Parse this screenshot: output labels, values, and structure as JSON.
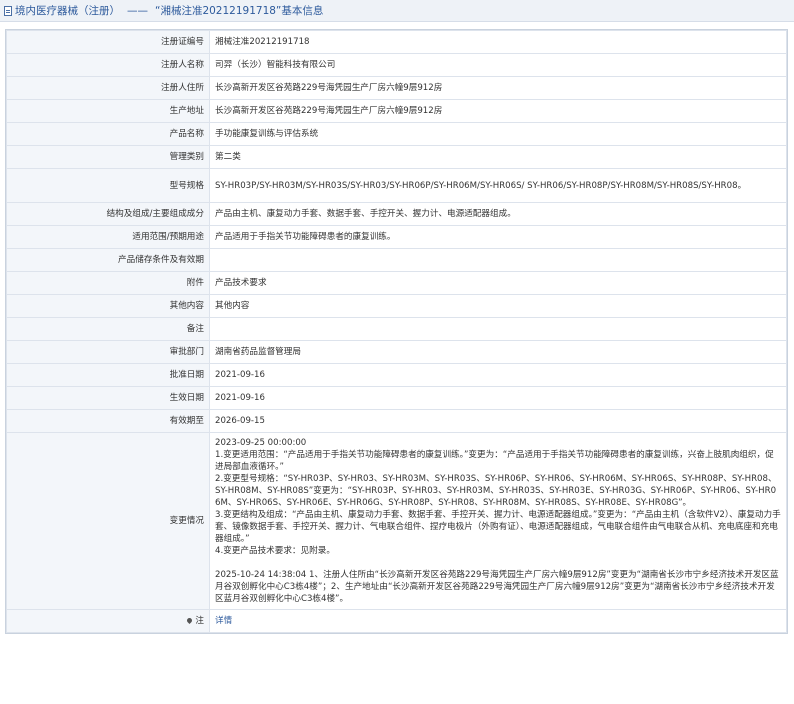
{
  "header": {
    "category": "境内医疗器械（注册）",
    "separator": "——",
    "subject": "“湘械注准20212191718”基本信息"
  },
  "rows": [
    {
      "label": "注册证编号",
      "value": "湘械注准20212191718"
    },
    {
      "label": "注册人名称",
      "value": "司羿（长沙）智能科技有限公司"
    },
    {
      "label": "注册人住所",
      "value": "长沙高新开发区谷苑路229号海凭园生产厂房六幢9层912房"
    },
    {
      "label": "生产地址",
      "value": "长沙高新开发区谷苑路229号海凭园生产厂房六幢9层912房"
    },
    {
      "label": "产品名称",
      "value": "手功能康复训练与评估系统"
    },
    {
      "label": "管理类别",
      "value": "第二类"
    },
    {
      "label": "型号规格",
      "value": "SY-HR03P/SY-HR03M/SY-HR03S/SY-HR03/SY-HR06P/SY-HR06M/SY-HR06S/ SY-HR06/SY-HR08P/SY-HR08M/SY-HR08S/SY-HR08。"
    },
    {
      "label": "结构及组成/主要组成成分",
      "value": "产品由主机、康复动力手套、数据手套、手控开关、握力计、电源适配器组成。"
    },
    {
      "label": "适用范围/预期用途",
      "value": "产品适用于手指关节功能障碍患者的康复训练。"
    },
    {
      "label": "产品储存条件及有效期",
      "value": ""
    },
    {
      "label": "附件",
      "value": "产品技术要求"
    },
    {
      "label": "其他内容",
      "value": "其他内容"
    },
    {
      "label": "备注",
      "value": ""
    },
    {
      "label": "审批部门",
      "value": "湖南省药品监督管理局"
    },
    {
      "label": "批准日期",
      "value": "2021-09-16"
    },
    {
      "label": "生效日期",
      "value": "2021-09-16"
    },
    {
      "label": "有效期至",
      "value": "2026-09-15"
    }
  ],
  "change": {
    "label": "变更情况",
    "lines1": [
      "2023-09-25 00:00:00",
      "1.变更适用范围：“产品适用于手指关节功能障碍患者的康复训练。”变更为：“产品适用于手指关节功能障碍患者的康复训练，兴奋上肢肌肉组织，促进局部血液循环。”",
      "2.变更型号规格：“SY-HR03P、SY-HR03、SY-HR03M、SY-HR03S、SY-HR06P、SY-HR06、SY-HR06M、SY-HR06S、SY-HR08P、SY-HR08、SY-HR08M、SY-HR08S”变更为：“SY-HR03P、SY-HR03、SY-HR03M、SY-HR03S、SY-HR03E、SY-HR03G、SY-HR06P、SY-HR06、SY-HR06M、SY-HR06S、SY-HR06E、SY-HR06G、SY-HR08P、SY-HR08、SY-HR08M、SY-HR08S、SY-HR08E、SY-HR08G”。",
      "3.变更结构及组成：“产品由主机、康复动力手套、数据手套、手控开关、握力计、电源适配器组成。”变更为：“产品由主机（含软件V2）、康复动力手套、镜像数据手套、手控开关、握力计、气电联合组件、捏疗电极片（外购有证）、电源适配器组成，气电联合组件由气电联合从机、充电底座和充电器组成。”",
      "4.变更产品技术要求：见附录。"
    ],
    "lines2": [
      "2025-10-24 14:38:04 1、注册人住所由“长沙高新开发区谷苑路229号海凭园生产厂房六幢9层912房”变更为“湖南省长沙市宁乡经济技术开发区蓝月谷双创孵化中心C3栋4楼”；2、生产地址由“长沙高新开发区谷苑路229号海凭园生产厂房六幢9层912房”变更为“湖南省长沙市宁乡经济技术开发区蓝月谷双创孵化中心C3栋4楼”。"
    ]
  },
  "note": {
    "label": "注",
    "link": "详情"
  }
}
